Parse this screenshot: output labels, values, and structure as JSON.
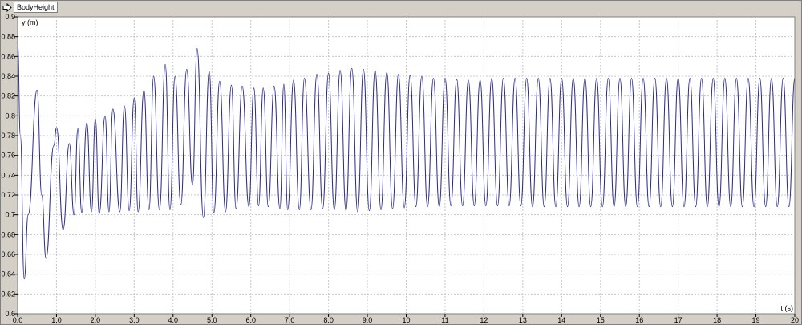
{
  "window": {
    "tab_label": "BodyHeight",
    "tab_icon": "arrow-right-icon"
  },
  "colors": {
    "line": "#2b2b8c",
    "grid": "#c8c8c8",
    "plot_bg": "#ffffff",
    "chrome": "#d4d0c8"
  },
  "chart_data": {
    "type": "line",
    "title": "",
    "xlabel": "t (s)",
    "ylabel": "y (m)",
    "xlim": [
      0,
      20
    ],
    "ylim": [
      0.6,
      0.9
    ],
    "grid": true,
    "xticks": [
      "0.0",
      "1.0",
      "2.0",
      "3.0",
      "4.0",
      "5.0",
      "6.0",
      "7.0",
      "8.0",
      "9.0",
      "10",
      "11",
      "12",
      "13",
      "14",
      "15",
      "16",
      "17",
      "18",
      "19",
      "20"
    ],
    "yticks": [
      "0.6",
      "0.62",
      "0.64",
      "0.66",
      "0.68",
      "0.7",
      "0.72",
      "0.74",
      "0.76",
      "0.78",
      "0.8",
      "0.82",
      "0.84",
      "0.86",
      "0.88",
      "0.9"
    ],
    "series": [
      {
        "name": "",
        "x": [
          0.0,
          0.07,
          0.17,
          0.27,
          0.5,
          0.62,
          0.73,
          0.93,
          1.0,
          1.17,
          1.33,
          1.45,
          1.55,
          1.65,
          1.78,
          1.9,
          2.0,
          2.1,
          2.25,
          2.35,
          2.45,
          2.63,
          2.75,
          2.87,
          3.0,
          3.1,
          3.25,
          3.38,
          3.5,
          3.65,
          3.8,
          3.92,
          4.05,
          4.2,
          4.35,
          4.5,
          4.62,
          4.78,
          4.93,
          5.05,
          5.2,
          5.35,
          5.5,
          5.62,
          5.78,
          5.95,
          6.08,
          6.2,
          6.32,
          6.45,
          6.6,
          6.75,
          6.85,
          6.95,
          7.1,
          7.25,
          7.38,
          7.55,
          7.7,
          7.85,
          8.0,
          8.15,
          8.3,
          8.45,
          8.6,
          8.75,
          8.9,
          9.05,
          9.2,
          9.35,
          9.5,
          9.65,
          9.8,
          9.95,
          10.1,
          10.25,
          10.4,
          10.55,
          10.7,
          10.85,
          11.0,
          11.15,
          11.3,
          11.45,
          11.6,
          11.75,
          11.9,
          12.05,
          12.2,
          12.35,
          12.5,
          12.65,
          12.8,
          12.95,
          13.1,
          13.25,
          13.4,
          13.55,
          13.7,
          13.85,
          14.0,
          14.15,
          14.3,
          14.45,
          14.6,
          14.75,
          14.9,
          15.05,
          15.2,
          15.35,
          15.5,
          15.65,
          15.8,
          15.95,
          16.1,
          16.25,
          16.4,
          16.55,
          16.7,
          16.85,
          17.0,
          17.15,
          17.3,
          17.45,
          17.6,
          17.75,
          17.9,
          18.05,
          18.2,
          18.35,
          18.5,
          18.65,
          18.8,
          18.95,
          19.1,
          19.25,
          19.4,
          19.55,
          19.7,
          19.85,
          20.0
        ],
        "y": [
          0.873,
          0.78,
          0.635,
          0.7,
          0.826,
          0.72,
          0.656,
          0.77,
          0.788,
          0.685,
          0.772,
          0.7,
          0.787,
          0.702,
          0.793,
          0.703,
          0.797,
          0.701,
          0.8,
          0.703,
          0.807,
          0.703,
          0.81,
          0.704,
          0.818,
          0.703,
          0.826,
          0.705,
          0.84,
          0.705,
          0.852,
          0.705,
          0.84,
          0.71,
          0.847,
          0.73,
          0.868,
          0.697,
          0.845,
          0.702,
          0.835,
          0.703,
          0.831,
          0.706,
          0.83,
          0.708,
          0.828,
          0.709,
          0.828,
          0.708,
          0.83,
          0.706,
          0.832,
          0.705,
          0.836,
          0.705,
          0.838,
          0.705,
          0.842,
          0.706,
          0.843,
          0.705,
          0.846,
          0.704,
          0.848,
          0.703,
          0.847,
          0.704,
          0.846,
          0.705,
          0.844,
          0.706,
          0.842,
          0.707,
          0.841,
          0.708,
          0.84,
          0.708,
          0.838,
          0.708,
          0.838,
          0.709,
          0.837,
          0.709,
          0.836,
          0.709,
          0.836,
          0.709,
          0.838,
          0.709,
          0.838,
          0.709,
          0.838,
          0.709,
          0.838,
          0.708,
          0.838,
          0.708,
          0.838,
          0.708,
          0.838,
          0.708,
          0.838,
          0.708,
          0.838,
          0.708,
          0.838,
          0.708,
          0.838,
          0.708,
          0.838,
          0.708,
          0.838,
          0.708,
          0.838,
          0.708,
          0.838,
          0.708,
          0.838,
          0.708,
          0.838,
          0.708,
          0.838,
          0.708,
          0.838,
          0.708,
          0.838,
          0.708,
          0.838,
          0.708,
          0.838,
          0.708,
          0.838,
          0.708,
          0.838,
          0.708,
          0.838,
          0.708,
          0.838,
          0.708,
          0.838
        ]
      }
    ]
  }
}
